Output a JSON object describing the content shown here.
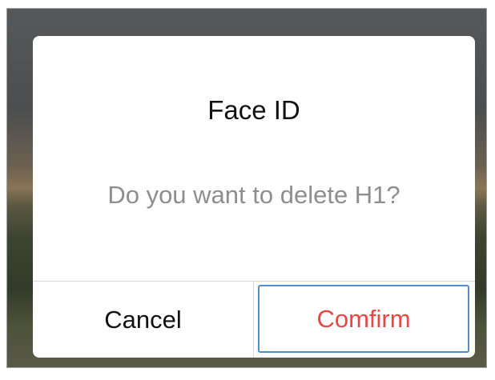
{
  "dialog": {
    "title": "Face ID",
    "message": "Do you want to delete H1?",
    "buttons": {
      "cancel_label": "Cancel",
      "confirm_label": "Comfirm"
    },
    "colors": {
      "confirm_text": "#e64848",
      "focus_border": "#4f8fc6",
      "message_text": "#8e8e8e"
    }
  }
}
